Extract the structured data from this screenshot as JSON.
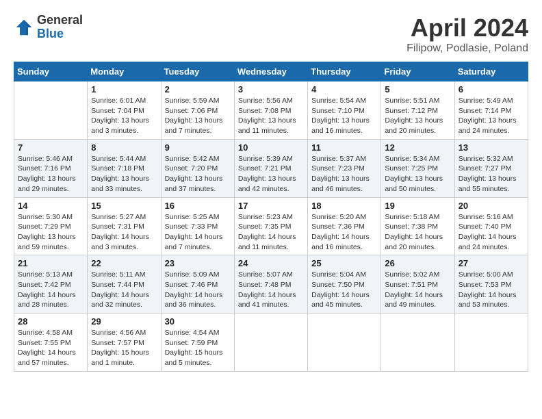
{
  "header": {
    "logo_general": "General",
    "logo_blue": "Blue",
    "month_year": "April 2024",
    "location": "Filipow, Podlasie, Poland"
  },
  "weekdays": [
    "Sunday",
    "Monday",
    "Tuesday",
    "Wednesday",
    "Thursday",
    "Friday",
    "Saturday"
  ],
  "weeks": [
    [
      {
        "day": "",
        "sunrise": "",
        "sunset": "",
        "daylight": ""
      },
      {
        "day": "1",
        "sunrise": "6:01 AM",
        "sunset": "7:04 PM",
        "daylight": "13 hours and 3 minutes."
      },
      {
        "day": "2",
        "sunrise": "5:59 AM",
        "sunset": "7:06 PM",
        "daylight": "13 hours and 7 minutes."
      },
      {
        "day": "3",
        "sunrise": "5:56 AM",
        "sunset": "7:08 PM",
        "daylight": "13 hours and 11 minutes."
      },
      {
        "day": "4",
        "sunrise": "5:54 AM",
        "sunset": "7:10 PM",
        "daylight": "13 hours and 16 minutes."
      },
      {
        "day": "5",
        "sunrise": "5:51 AM",
        "sunset": "7:12 PM",
        "daylight": "13 hours and 20 minutes."
      },
      {
        "day": "6",
        "sunrise": "5:49 AM",
        "sunset": "7:14 PM",
        "daylight": "13 hours and 24 minutes."
      }
    ],
    [
      {
        "day": "7",
        "sunrise": "5:46 AM",
        "sunset": "7:16 PM",
        "daylight": "13 hours and 29 minutes."
      },
      {
        "day": "8",
        "sunrise": "5:44 AM",
        "sunset": "7:18 PM",
        "daylight": "13 hours and 33 minutes."
      },
      {
        "day": "9",
        "sunrise": "5:42 AM",
        "sunset": "7:20 PM",
        "daylight": "13 hours and 37 minutes."
      },
      {
        "day": "10",
        "sunrise": "5:39 AM",
        "sunset": "7:21 PM",
        "daylight": "13 hours and 42 minutes."
      },
      {
        "day": "11",
        "sunrise": "5:37 AM",
        "sunset": "7:23 PM",
        "daylight": "13 hours and 46 minutes."
      },
      {
        "day": "12",
        "sunrise": "5:34 AM",
        "sunset": "7:25 PM",
        "daylight": "13 hours and 50 minutes."
      },
      {
        "day": "13",
        "sunrise": "5:32 AM",
        "sunset": "7:27 PM",
        "daylight": "13 hours and 55 minutes."
      }
    ],
    [
      {
        "day": "14",
        "sunrise": "5:30 AM",
        "sunset": "7:29 PM",
        "daylight": "13 hours and 59 minutes."
      },
      {
        "day": "15",
        "sunrise": "5:27 AM",
        "sunset": "7:31 PM",
        "daylight": "14 hours and 3 minutes."
      },
      {
        "day": "16",
        "sunrise": "5:25 AM",
        "sunset": "7:33 PM",
        "daylight": "14 hours and 7 minutes."
      },
      {
        "day": "17",
        "sunrise": "5:23 AM",
        "sunset": "7:35 PM",
        "daylight": "14 hours and 11 minutes."
      },
      {
        "day": "18",
        "sunrise": "5:20 AM",
        "sunset": "7:36 PM",
        "daylight": "14 hours and 16 minutes."
      },
      {
        "day": "19",
        "sunrise": "5:18 AM",
        "sunset": "7:38 PM",
        "daylight": "14 hours and 20 minutes."
      },
      {
        "day": "20",
        "sunrise": "5:16 AM",
        "sunset": "7:40 PM",
        "daylight": "14 hours and 24 minutes."
      }
    ],
    [
      {
        "day": "21",
        "sunrise": "5:13 AM",
        "sunset": "7:42 PM",
        "daylight": "14 hours and 28 minutes."
      },
      {
        "day": "22",
        "sunrise": "5:11 AM",
        "sunset": "7:44 PM",
        "daylight": "14 hours and 32 minutes."
      },
      {
        "day": "23",
        "sunrise": "5:09 AM",
        "sunset": "7:46 PM",
        "daylight": "14 hours and 36 minutes."
      },
      {
        "day": "24",
        "sunrise": "5:07 AM",
        "sunset": "7:48 PM",
        "daylight": "14 hours and 41 minutes."
      },
      {
        "day": "25",
        "sunrise": "5:04 AM",
        "sunset": "7:50 PM",
        "daylight": "14 hours and 45 minutes."
      },
      {
        "day": "26",
        "sunrise": "5:02 AM",
        "sunset": "7:51 PM",
        "daylight": "14 hours and 49 minutes."
      },
      {
        "day": "27",
        "sunrise": "5:00 AM",
        "sunset": "7:53 PM",
        "daylight": "14 hours and 53 minutes."
      }
    ],
    [
      {
        "day": "28",
        "sunrise": "4:58 AM",
        "sunset": "7:55 PM",
        "daylight": "14 hours and 57 minutes."
      },
      {
        "day": "29",
        "sunrise": "4:56 AM",
        "sunset": "7:57 PM",
        "daylight": "15 hours and 1 minute."
      },
      {
        "day": "30",
        "sunrise": "4:54 AM",
        "sunset": "7:59 PM",
        "daylight": "15 hours and 5 minutes."
      },
      {
        "day": "",
        "sunrise": "",
        "sunset": "",
        "daylight": ""
      },
      {
        "day": "",
        "sunrise": "",
        "sunset": "",
        "daylight": ""
      },
      {
        "day": "",
        "sunrise": "",
        "sunset": "",
        "daylight": ""
      },
      {
        "day": "",
        "sunrise": "",
        "sunset": "",
        "daylight": ""
      }
    ]
  ]
}
